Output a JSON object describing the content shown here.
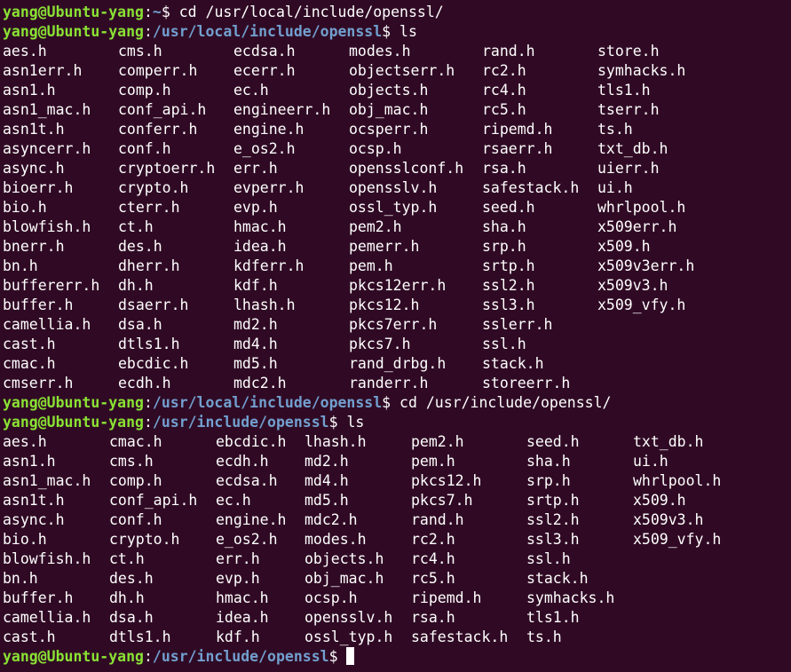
{
  "session": {
    "user_host": "yang@Ubuntu-yang",
    "colon": ":",
    "dollar": "$",
    "colors": {
      "background": "#300a24",
      "prompt_user": "#8ae234",
      "prompt_path": "#729fcf",
      "text": "#ffffff"
    }
  },
  "prompts": [
    {
      "path": "~",
      "command": "cd /usr/local/include/openssl/"
    },
    {
      "path": "/usr/local/include/openssl",
      "command": "ls"
    },
    {
      "path": "/usr/local/include/openssl",
      "command": "cd /usr/include/openssl/"
    },
    {
      "path": "/usr/include/openssl",
      "command": "ls"
    },
    {
      "path": "/usr/include/openssl",
      "command": ""
    }
  ],
  "listing1": [
    [
      "aes.h",
      "cms.h",
      "ecdsa.h",
      "modes.h",
      "rand.h",
      "store.h"
    ],
    [
      "asn1err.h",
      "comperr.h",
      "ecerr.h",
      "objectserr.h",
      "rc2.h",
      "symhacks.h"
    ],
    [
      "asn1.h",
      "comp.h",
      "ec.h",
      "objects.h",
      "rc4.h",
      "tls1.h"
    ],
    [
      "asn1_mac.h",
      "conf_api.h",
      "engineerr.h",
      "obj_mac.h",
      "rc5.h",
      "tserr.h"
    ],
    [
      "asn1t.h",
      "conferr.h",
      "engine.h",
      "ocsperr.h",
      "ripemd.h",
      "ts.h"
    ],
    [
      "asyncerr.h",
      "conf.h",
      "e_os2.h",
      "ocsp.h",
      "rsaerr.h",
      "txt_db.h"
    ],
    [
      "async.h",
      "cryptoerr.h",
      "err.h",
      "opensslconf.h",
      "rsa.h",
      "uierr.h"
    ],
    [
      "bioerr.h",
      "crypto.h",
      "evperr.h",
      "opensslv.h",
      "safestack.h",
      "ui.h"
    ],
    [
      "bio.h",
      "cterr.h",
      "evp.h",
      "ossl_typ.h",
      "seed.h",
      "whrlpool.h"
    ],
    [
      "blowfish.h",
      "ct.h",
      "hmac.h",
      "pem2.h",
      "sha.h",
      "x509err.h"
    ],
    [
      "bnerr.h",
      "des.h",
      "idea.h",
      "pemerr.h",
      "srp.h",
      "x509.h"
    ],
    [
      "bn.h",
      "dherr.h",
      "kdferr.h",
      "pem.h",
      "srtp.h",
      "x509v3err.h"
    ],
    [
      "buffererr.h",
      "dh.h",
      "kdf.h",
      "pkcs12err.h",
      "ssl2.h",
      "x509v3.h"
    ],
    [
      "buffer.h",
      "dsaerr.h",
      "lhash.h",
      "pkcs12.h",
      "ssl3.h",
      "x509_vfy.h"
    ],
    [
      "camellia.h",
      "dsa.h",
      "md2.h",
      "pkcs7err.h",
      "sslerr.h",
      ""
    ],
    [
      "cast.h",
      "dtls1.h",
      "md4.h",
      "pkcs7.h",
      "ssl.h",
      ""
    ],
    [
      "cmac.h",
      "ebcdic.h",
      "md5.h",
      "rand_drbg.h",
      "stack.h",
      ""
    ],
    [
      "cmserr.h",
      "ecdh.h",
      "mdc2.h",
      "randerr.h",
      "storeerr.h",
      ""
    ]
  ],
  "listing2": [
    [
      "aes.h",
      "cmac.h",
      "ebcdic.h",
      "lhash.h",
      "pem2.h",
      "seed.h",
      "txt_db.h"
    ],
    [
      "asn1.h",
      "cms.h",
      "ecdh.h",
      "md2.h",
      "pem.h",
      "sha.h",
      "ui.h"
    ],
    [
      "asn1_mac.h",
      "comp.h",
      "ecdsa.h",
      "md4.h",
      "pkcs12.h",
      "srp.h",
      "whrlpool.h"
    ],
    [
      "asn1t.h",
      "conf_api.h",
      "ec.h",
      "md5.h",
      "pkcs7.h",
      "srtp.h",
      "x509.h"
    ],
    [
      "async.h",
      "conf.h",
      "engine.h",
      "mdc2.h",
      "rand.h",
      "ssl2.h",
      "x509v3.h"
    ],
    [
      "bio.h",
      "crypto.h",
      "e_os2.h",
      "modes.h",
      "rc2.h",
      "ssl3.h",
      "x509_vfy.h"
    ],
    [
      "blowfish.h",
      "ct.h",
      "err.h",
      "objects.h",
      "rc4.h",
      "ssl.h",
      ""
    ],
    [
      "bn.h",
      "des.h",
      "evp.h",
      "obj_mac.h",
      "rc5.h",
      "stack.h",
      ""
    ],
    [
      "buffer.h",
      "dh.h",
      "hmac.h",
      "ocsp.h",
      "ripemd.h",
      "symhacks.h",
      ""
    ],
    [
      "camellia.h",
      "dsa.h",
      "idea.h",
      "opensslv.h",
      "rsa.h",
      "tls1.h",
      ""
    ],
    [
      "cast.h",
      "dtls1.h",
      "kdf.h",
      "ossl_typ.h",
      "safestack.h",
      "ts.h",
      ""
    ]
  ]
}
